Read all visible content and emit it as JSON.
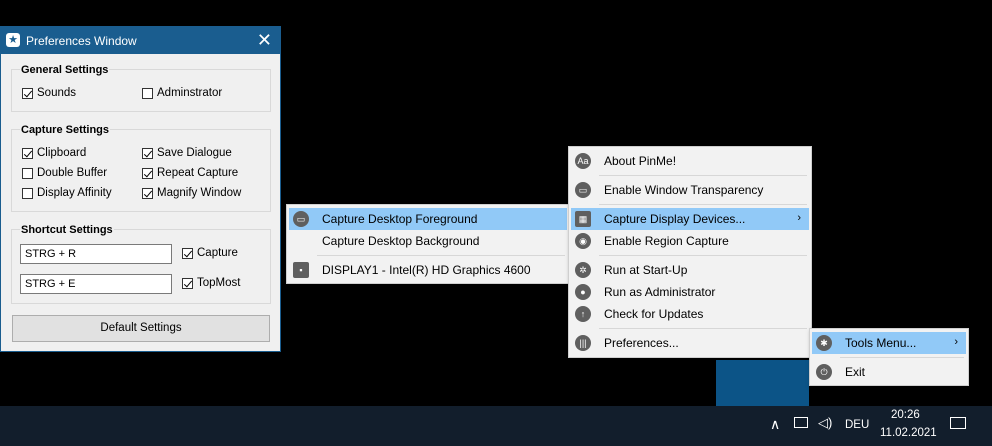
{
  "preferences": {
    "title": "Preferences Window",
    "close_glyph": "✕",
    "general": {
      "heading": "General Settings",
      "sounds": {
        "label": "Sounds",
        "checked": true
      },
      "administrator": {
        "label": "Adminstrator",
        "checked": false
      }
    },
    "capture": {
      "heading": "Capture Settings",
      "clipboard": {
        "label": "Clipboard",
        "checked": true
      },
      "save_dialogue": {
        "label": "Save Dialogue",
        "checked": true
      },
      "double_buffer": {
        "label": "Double Buffer",
        "checked": false
      },
      "repeat_capture": {
        "label": "Repeat Capture",
        "checked": true
      },
      "display_affinity": {
        "label": "Display Affinity",
        "checked": false
      },
      "magnify_window": {
        "label": "Magnify Window",
        "checked": true
      }
    },
    "shortcut": {
      "heading": "Shortcut Settings",
      "capture_key": "STRG + R",
      "capture": {
        "label": "Capture",
        "checked": true
      },
      "topmost_key": "STRG + E",
      "topmost": {
        "label": "TopMost",
        "checked": true
      }
    },
    "default_button": "Default Settings"
  },
  "submenu_display": {
    "items": [
      "Capture Desktop Foreground",
      "Capture Desktop Background",
      "DISPLAY1 - Intel(R) HD Graphics 4600"
    ]
  },
  "main_menu": {
    "items": [
      "About PinMe!",
      "Enable Window Transparency",
      "Capture Display Devices...",
      "Enable Region Capture",
      "Run at Start-Up",
      "Run as Administrator",
      "Check for Updates",
      "Preferences..."
    ],
    "submenu_arrow": "›"
  },
  "tray_menu": {
    "items": [
      "Tools Menu...",
      "Exit"
    ],
    "submenu_arrow": "›"
  },
  "taskbar": {
    "chevron": "∧",
    "language": "DEU",
    "time": "20:26",
    "date": "11.02.2021"
  },
  "colors": {
    "accent": "#1a5d8f",
    "highlight": "#91c9f7",
    "taskbar": "#121e2c"
  }
}
